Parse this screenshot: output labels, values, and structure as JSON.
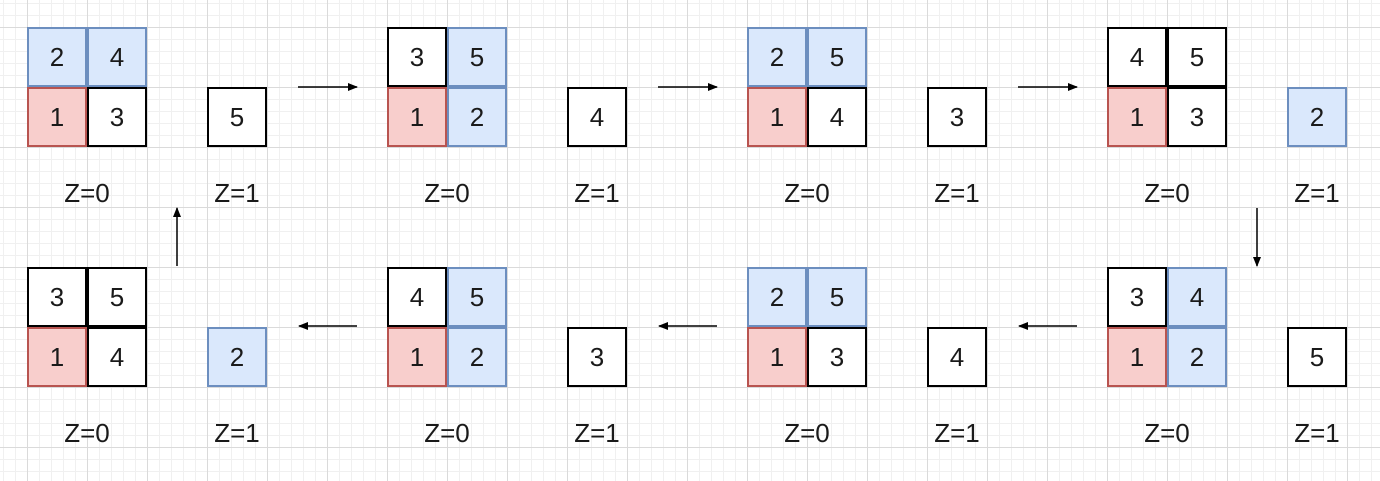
{
  "colors": {
    "white_fill": "#ffffff",
    "white_border": "#000000",
    "blue_fill": "#dae8fc",
    "blue_border": "#6c8ebf",
    "red_fill": "#f8cecc",
    "red_border": "#b85450",
    "arrow": "#000000",
    "grid": "#dadada"
  },
  "flow_order": [
    0,
    1,
    2,
    3,
    4,
    5,
    6,
    7
  ],
  "states": [
    {
      "z0": [
        [
          "2",
          "4"
        ],
        [
          "1",
          "3"
        ]
      ],
      "z0_colors": [
        [
          "blue",
          "blue"
        ],
        [
          "red",
          "white"
        ]
      ],
      "z1": "5",
      "z1_color": "white",
      "z0_label": "Z=0",
      "z1_label": "Z=1"
    },
    {
      "z0": [
        [
          "3",
          "5"
        ],
        [
          "1",
          "2"
        ]
      ],
      "z0_colors": [
        [
          "white",
          "blue"
        ],
        [
          "red",
          "blue"
        ]
      ],
      "z1": "4",
      "z1_color": "white",
      "z0_label": "Z=0",
      "z1_label": "Z=1"
    },
    {
      "z0": [
        [
          "2",
          "5"
        ],
        [
          "1",
          "4"
        ]
      ],
      "z0_colors": [
        [
          "blue",
          "blue"
        ],
        [
          "red",
          "white"
        ]
      ],
      "z1": "3",
      "z1_color": "white",
      "z0_label": "Z=0",
      "z1_label": "Z=1"
    },
    {
      "z0": [
        [
          "4",
          "5"
        ],
        [
          "1",
          "3"
        ]
      ],
      "z0_colors": [
        [
          "white",
          "white"
        ],
        [
          "red",
          "white"
        ]
      ],
      "z1": "2",
      "z1_color": "blue",
      "z0_label": "Z=0",
      "z1_label": "Z=1"
    },
    {
      "z0": [
        [
          "3",
          "4"
        ],
        [
          "1",
          "2"
        ]
      ],
      "z0_colors": [
        [
          "white",
          "blue"
        ],
        [
          "red",
          "blue"
        ]
      ],
      "z1": "5",
      "z1_color": "white",
      "z0_label": "Z=0",
      "z1_label": "Z=1"
    },
    {
      "z0": [
        [
          "2",
          "5"
        ],
        [
          "1",
          "3"
        ]
      ],
      "z0_colors": [
        [
          "blue",
          "blue"
        ],
        [
          "red",
          "white"
        ]
      ],
      "z1": "4",
      "z1_color": "white",
      "z0_label": "Z=0",
      "z1_label": "Z=1"
    },
    {
      "z0": [
        [
          "4",
          "5"
        ],
        [
          "1",
          "2"
        ]
      ],
      "z0_colors": [
        [
          "white",
          "blue"
        ],
        [
          "red",
          "blue"
        ]
      ],
      "z1": "3",
      "z1_color": "white",
      "z0_label": "Z=0",
      "z1_label": "Z=1"
    },
    {
      "z0": [
        [
          "3",
          "5"
        ],
        [
          "1",
          "4"
        ]
      ],
      "z0_colors": [
        [
          "white",
          "white"
        ],
        [
          "red",
          "white"
        ]
      ],
      "z1": "2",
      "z1_color": "blue",
      "z0_label": "Z=0",
      "z1_label": "Z=1"
    }
  ]
}
